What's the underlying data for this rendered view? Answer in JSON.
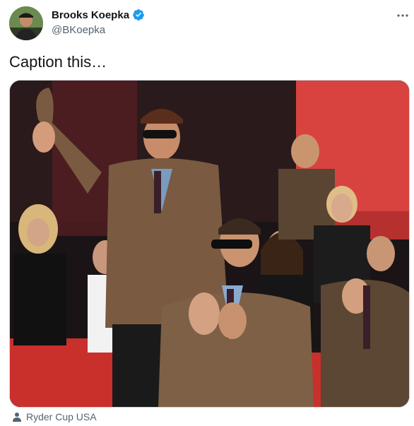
{
  "author": {
    "display_name": "Brooks Koepka",
    "handle": "@BKoepka",
    "verified": true,
    "avatar_icon": "profile-photo"
  },
  "tweet": {
    "text": "Caption this…"
  },
  "media": {
    "description_icon": "photo",
    "attribution": "Ryder Cup USA"
  },
  "colors": {
    "verified_blue": "#1d9bf0",
    "secondary_text": "#536471",
    "backdrop_red": "#d8433f"
  }
}
